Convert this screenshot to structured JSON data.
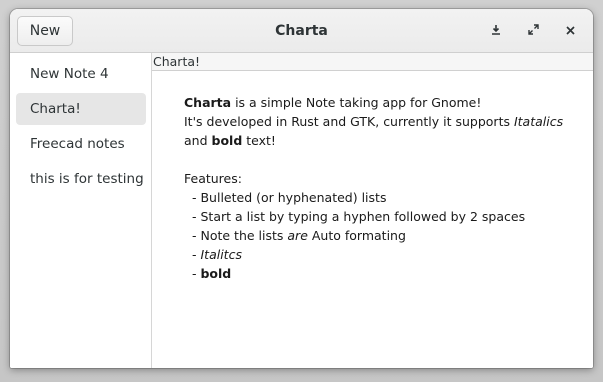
{
  "window": {
    "title": "Charta",
    "new_button_label": "New",
    "icons": {
      "download": "download-icon",
      "maximize": "maximize-icon",
      "close": "close-icon"
    }
  },
  "sidebar": {
    "items": [
      {
        "label": "New Note 4",
        "selected": false
      },
      {
        "label": "Charta!",
        "selected": true
      },
      {
        "label": "Freecad notes",
        "selected": false
      },
      {
        "label": "this is for testing",
        "selected": false
      }
    ]
  },
  "note": {
    "title": "Charta!",
    "intro_bold": "Charta",
    "intro_rest": " is a simple Note taking app for Gnome!",
    "line2_text": "It's developed in Rust and GTK, currently it supports ",
    "line2_italic": "Itatalics",
    "line3_prefix": "and ",
    "line3_bold": "bold",
    "line3_suffix": " text!",
    "features_heading": "Features:",
    "feature_1": "- Bulleted (or hyphenated) lists",
    "feature_2": "- Start a list by typing a hyphen followed by 2 spaces",
    "feature_3_prefix": "- Note the lists ",
    "feature_3_italic": "are",
    "feature_3_suffix": " Auto formating",
    "feature_4_prefix": "- ",
    "feature_4_italic": "Italitcs",
    "feature_5_prefix": "- ",
    "feature_5_bold": "bold"
  }
}
